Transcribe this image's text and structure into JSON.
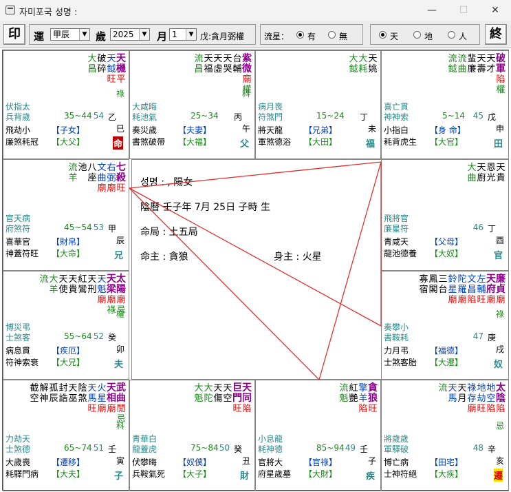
{
  "window": {
    "title": "자미포국   성명 :",
    "min": "—",
    "max": "☐",
    "close": "✕"
  },
  "toolbar": {
    "print_btn": "印",
    "yun_label": "運",
    "yun_value": "甲辰",
    "sui_label": "歲",
    "sui_value": "2025",
    "yue_label": "月",
    "yue_value": "1",
    "yue_info": "戊:貪月弼權",
    "liuxing_label": "流星：",
    "opt_you": "有",
    "opt_wu": "無",
    "opt_tian": "天",
    "opt_di": "地",
    "opt_ren": "人",
    "end_btn": "終"
  },
  "center": {
    "name_line": "성명 : , 陽女",
    "lunar_line": "陰曆  壬子年    7月  25日  子時  生",
    "ju_line": "命局 : 土五局",
    "mingzhu_line": "命主 :  貪狼",
    "shenzhu_line": "身主 :  火星"
  },
  "cells": [
    {
      "id": "si",
      "stars": [
        [
          "天",
          "機",
          "平"
        ],
        [
          "天",
          "鉞",
          "旺"
        ],
        [
          "破",
          "碎"
        ],
        [
          "大",
          "昌"
        ]
      ],
      "hua": "祿",
      "luck": "35~44",
      "age": "54",
      "stem": "乙巳",
      "ganzhi_a": "乙",
      "ganzhi_b": "巳",
      "palace": "子女",
      "dapalace": "大父",
      "ming": "命",
      "left1": "伏指太",
      "left2": "兵背歲",
      "left3": "飛劫小",
      "left4": "廉煞耗冠"
    },
    {
      "id": "wu",
      "stars": [
        [
          "紫",
          "微",
          "廟",
          "權"
        ],
        [
          "台",
          "輔"
        ],
        [
          "天",
          "哭"
        ],
        [
          "天",
          "虛"
        ],
        [
          "天",
          "福"
        ],
        [
          "流",
          "昌"
        ]
      ],
      "hua": "科",
      "luck": "25~34",
      "age": "",
      "stem": "丙午",
      "ganzhi_a": "丙",
      "ganzhi_b": "午",
      "palace": "夫妻",
      "dapalace": "大福",
      "ming": "父",
      "left1": "大咸晦",
      "left2": "耗池氣",
      "left3": "奏災歲",
      "left4": "書煞破帶"
    },
    {
      "id": "wei",
      "stars": [
        [
          "天",
          "姚"
        ],
        [
          "大",
          "耗"
        ],
        [
          "大",
          "鉞"
        ]
      ],
      "luck": "15~24",
      "age": "",
      "stem": "丁未",
      "ganzhi_a": "丁",
      "ganzhi_b": "未",
      "palace": "兄弟",
      "dapalace": "大田",
      "ming": "福",
      "left1": "病月喪",
      "left2": "符煞門",
      "left3": "將天龍",
      "left4": "軍煞德浴"
    },
    {
      "id": "shen",
      "stars": [
        [
          "破",
          "軍",
          "陷",
          "權"
        ],
        [
          "天",
          "才"
        ],
        [
          "天",
          "壽"
        ],
        [
          "蜚",
          "廉"
        ],
        [
          "流",
          "曲"
        ],
        [
          "流",
          "鉞"
        ]
      ],
      "luck": "5~14",
      "age": "45",
      "stem": "戊申",
      "ganzhi_a": "戊",
      "ganzhi_b": "申",
      "palace": "身  命",
      "dapalace": "大官",
      "ming": "田",
      "left1": "喜亡貫",
      "left2": "神神索",
      "left3": "小指白",
      "left4": "耗背虎生"
    },
    {
      "id": "chen",
      "stars": [
        [
          "七",
          "殺",
          "旺"
        ],
        [
          "右",
          "弼",
          "廟"
        ],
        [
          "文",
          "曲",
          "廟"
        ],
        [
          "八",
          "座"
        ],
        [
          "池"
        ],
        [
          "流",
          "羊"
        ]
      ],
      "luck": "45~54",
      "age": "53",
      "stem": "甲辰",
      "ganzhi_a": "甲",
      "ganzhi_b": "辰",
      "palace": "財帛",
      "dapalace": "大命",
      "ming": "兄",
      "left1": "官天病",
      "left2": "府煞符",
      "left3": "喜華官",
      "left4": "神蓋符旺"
    },
    {
      "id": "you",
      "stars": [
        [
          "天",
          "貴"
        ],
        [
          "恩",
          "光"
        ],
        [
          "天",
          "廚"
        ],
        [
          "大",
          "曲"
        ]
      ],
      "luck": "",
      "age": "46",
      "stem": "丁酉",
      "ganzhi_a": "丁",
      "ganzhi_b": "酉",
      "palace": "父母",
      "dapalace": "大奴",
      "ming": "官",
      "left1": "飛將官",
      "left2": "廉星符",
      "left3": "青咸天",
      "left4": "龍池德養"
    },
    {
      "id": "mao",
      "stars": [
        [
          "太",
          "陽",
          "廟",
          "忌"
        ],
        [
          "天",
          "梁",
          "廟",
          "祿"
        ],
        [
          "天",
          "魁",
          "廟"
        ],
        [
          "天",
          "刑"
        ],
        [
          "紅",
          "鸞"
        ],
        [
          "天",
          "貴"
        ],
        [
          "天",
          "使"
        ],
        [
          "大",
          "羊"
        ],
        [
          "流"
        ]
      ],
      "hua": "權",
      "luck": "55~64",
      "age": "52",
      "stem": "癸卯",
      "ganzhi_a": "癸",
      "ganzhi_b": "卯",
      "palace": "疾厄",
      "dapalace": "大兄",
      "ming": "夫",
      "left1": "博災弔",
      "left2": "士煞客",
      "left3": "病息貫",
      "left4": "符神索衰"
    },
    {
      "id": "xu",
      "stars": [
        [
          "廉",
          "貞",
          "廟"
        ],
        [
          "天",
          "府",
          "廟"
        ],
        [
          "左",
          "輔",
          "旺"
        ],
        [
          "文",
          "昌",
          "陷"
        ],
        [
          "陀",
          "羅",
          "廟"
        ],
        [
          "鈴",
          "星",
          "廟"
        ],
        [
          "三",
          "台"
        ],
        [
          "鳳",
          "閣"
        ],
        [
          "寡",
          "宿"
        ]
      ],
      "hua": "祿",
      "luck": "",
      "age": "47",
      "stem": "庚戌",
      "ganzhi_a": "庚",
      "ganzhi_b": "戌",
      "palace": "福德",
      "dapalace": "大遷",
      "ming": "奴",
      "left1": "奏攀小",
      "left2": "書鞍耗",
      "left3": "力月弔",
      "left4": "士煞客胎"
    },
    {
      "id": "yin",
      "stars": [
        [
          "武",
          "曲",
          "閒",
          "忌"
        ],
        [
          "天",
          "相",
          "廟"
        ],
        [
          "火",
          "星",
          "廟"
        ],
        [
          "天",
          "馬",
          "旺"
        ],
        [
          "陰",
          "煞"
        ],
        [
          "天",
          "巫"
        ],
        [
          "封",
          "誥"
        ],
        [
          "孤",
          "辰"
        ],
        [
          "解",
          "神"
        ],
        [
          "截",
          "空"
        ]
      ],
      "hua": "科",
      "luck": "65~74",
      "age": "51",
      "stem": "壬寅",
      "ganzhi_a": "壬",
      "ganzhi_b": "寅",
      "palace": "遷移",
      "dapalace": "大夫",
      "ming": "子",
      "left1": "力劫天",
      "left2": "士煞德",
      "left3": "大歲喪",
      "left4": "耗驛門病"
    },
    {
      "id": "chou",
      "stars": [
        [
          "天",
          "同",
          "陷"
        ],
        [
          "巨",
          "門",
          "旺"
        ],
        [
          "天",
          "空"
        ],
        [
          "天",
          "傷"
        ],
        [
          "大",
          "陀"
        ],
        [
          "大",
          "魁"
        ]
      ],
      "luck": "75~84",
      "age": "50",
      "stem": "癸丑",
      "ganzhi_a": "癸",
      "ganzhi_b": "丑",
      "palace": "奴僕",
      "dapalace": "大子",
      "ming": "財",
      "left1": "青華白",
      "left2": "龍蓋虎",
      "left3": "伏攀晦",
      "left4": "兵鞍氣死"
    },
    {
      "id": "zi",
      "stars": [
        [
          "貪",
          "狼",
          "旺"
        ],
        [
          "擎",
          "羊",
          "陷"
        ],
        [
          "紅",
          "艷"
        ],
        [
          "流",
          "魁"
        ]
      ],
      "luck": "85~94",
      "age": "49",
      "stem": "壬子",
      "ganzhi_a": "壬",
      "ganzhi_b": "子",
      "palace": "官祿",
      "dapalace": "大財",
      "ming": "疾",
      "left1": "小息龍",
      "left2": "耗神德",
      "left3": "官將大",
      "left4": "府星歲墓"
    },
    {
      "id": "hai",
      "stars": [
        [
          "太",
          "陰",
          "陷"
        ],
        [
          "地",
          "空",
          "陷"
        ],
        [
          "地",
          "劫",
          "旺"
        ],
        [
          "祿",
          "存",
          "廟"
        ],
        [
          "天",
          "月"
        ],
        [
          "天",
          "馬"
        ],
        [
          "流"
        ]
      ],
      "hua": "忌",
      "luck": "",
      "age": "48",
      "stem": "辛亥",
      "ganzhi_a": "辛",
      "ganzhi_b": "亥",
      "palace": "田宅",
      "dapalace": "大疾",
      "ming": "遷",
      "left1": "將歲歲",
      "left2": "軍驛破",
      "left3": "博亡病",
      "left4": "士神符絕"
    }
  ]
}
